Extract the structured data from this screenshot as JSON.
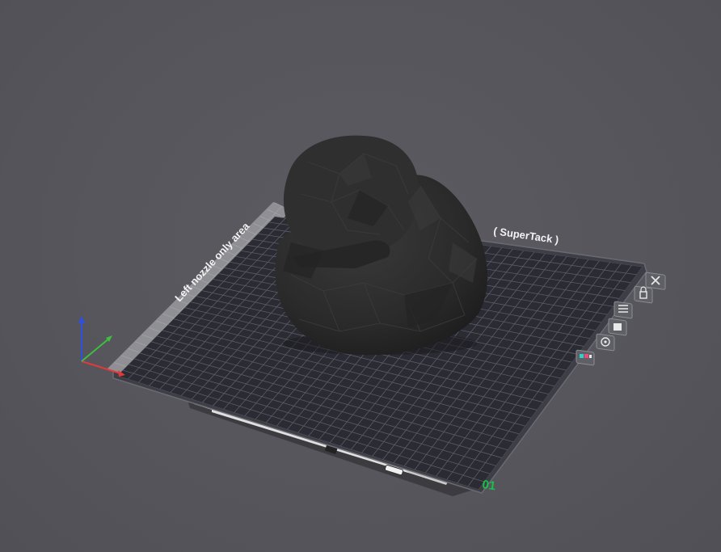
{
  "plate": {
    "left_zone_label": "Left nozzle only area",
    "surface_label": "( SuperTack )",
    "plate_number": "01"
  },
  "colors": {
    "background": "#56565c",
    "plate_surface": "#2b2b33",
    "grid_line": "#5c5c68",
    "left_zone": "#8f8f94",
    "model": "#2e2e2e",
    "plate_number": "#19c04a",
    "axis_x": "#e23a3a",
    "axis_y": "#3fbf3f",
    "axis_z": "#2f4fe0"
  },
  "plate_toolbar": {
    "icons": [
      "close-plate-icon",
      "lock-plate-icon",
      "plate-settings-icon",
      "arrange-icon",
      "orient-icon",
      "auto-orient-icon",
      "filament-map-icon"
    ]
  }
}
